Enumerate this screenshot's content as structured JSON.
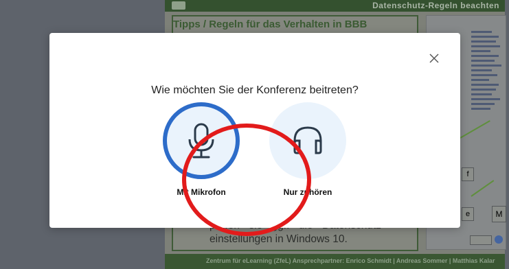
{
  "background": {
    "slide_title": "Tipps / Regeln für das Verhalten in BBB",
    "header_text": "Datenschutz-Regeln beachten",
    "slide_text": {
      "line1_words": [
        "prüfen",
        "sie",
        "ggf.",
        "die",
        "Datenschutz"
      ],
      "line2": "einstellungen in Windows 10."
    },
    "footer_text": "Zentrum für eLearning (ZfeL)   Ansprechpartner: Enrico Schmidt | Andreas Sommer | Matthias Kalar",
    "side_box_labels": [
      "f",
      "e",
      "M"
    ]
  },
  "modal": {
    "title": "Wie möchten Sie der Konferenz beitreten?",
    "close_icon": "close-icon",
    "options": [
      {
        "label": "Mit Mikrofon",
        "icon": "microphone-icon",
        "selected": true
      },
      {
        "label": "Nur zuhören",
        "icon": "headphones-icon",
        "selected": false
      }
    ]
  },
  "colors": {
    "accent": "#2d6cc9",
    "option_bg": "#eaf3fc",
    "highlight_ring": "#e21b1b",
    "icon_stroke": "#2b3a4a"
  }
}
